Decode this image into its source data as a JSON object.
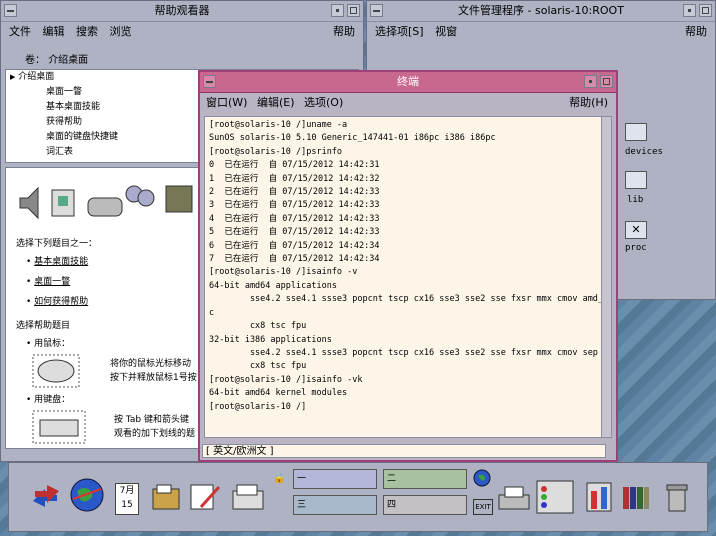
{
  "help_viewer": {
    "title": "帮助观看器",
    "menu": [
      "文件",
      "编辑",
      "搜索",
      "浏览"
    ],
    "help": "帮助",
    "volume_label": "卷：",
    "volume_value": "介绍桌面",
    "topics": [
      "介绍桌面",
      "桌面一瞥",
      "基本桌面技能",
      "获得帮助",
      "桌面的键盘快捷键",
      "词汇表"
    ],
    "select_prompt": "选择下列题目之一：",
    "links": [
      "基本桌面技能",
      "桌面一瞥",
      "如何获得帮助"
    ],
    "select_help": "选择帮助题目",
    "mouse_label": "用鼠标：",
    "mouse_text_1": "将你的鼠标光标移动",
    "mouse_text_2": "按下并释放鼠标1号按",
    "keyboard_label": "用键盘：",
    "keyboard_text_1": "按 Tab 键和箭头键",
    "keyboard_text_2": "观看的加下划线的题"
  },
  "file_manager": {
    "title": "文件管理程序 - solaris-10:ROOT",
    "menu": [
      "选择项[S]",
      "视窗"
    ],
    "help": "帮助",
    "folders": [
      "devices",
      "lib",
      "proc"
    ]
  },
  "terminal": {
    "title": "终端",
    "menu": [
      "窗口(W)",
      "编辑(E)",
      "选项(O)"
    ],
    "help": "帮助(H)",
    "lines": [
      "[root@solaris-10 /]uname -a",
      "SunOS solaris-10 5.10 Generic_147441-01 i86pc i386 i86pc",
      "[root@solaris-10 /]psrinfo",
      "0  已在运行  自 07/15/2012 14:42:31",
      "1  已在运行  自 07/15/2012 14:42:32",
      "2  已在运行  自 07/15/2012 14:42:33",
      "3  已在运行  自 07/15/2012 14:42:33",
      "4  已在运行  自 07/15/2012 14:42:33",
      "5  已在运行  自 07/15/2012 14:42:33",
      "6  已在运行  自 07/15/2012 14:42:34",
      "7  已在运行  自 07/15/2012 14:42:34",
      "[root@solaris-10 /]isainfo -v",
      "64-bit amd64 applications",
      "        sse4.2 sse4.1 ssse3 popcnt tscp cx16 sse3 sse2 sse fxsr mmx cmov amd_sys",
      "c",
      "        cx8 tsc fpu",
      "32-bit i386 applications",
      "        sse4.2 sse4.1 ssse3 popcnt tscp cx16 sse3 sse2 sse fxsr mmx cmov sep",
      "        cx8 tsc fpu",
      "[root@solaris-10 /]isainfo -vk",
      "64-bit amd64 kernel modules",
      "[root@solaris-10 /]"
    ],
    "status": "[ 英文/欧洲文 ]"
  },
  "panel": {
    "calendar_month": "7月",
    "calendar_day": "15",
    "workspaces": [
      "一",
      "二",
      "三",
      "四"
    ],
    "exit_label": "EXIT"
  }
}
